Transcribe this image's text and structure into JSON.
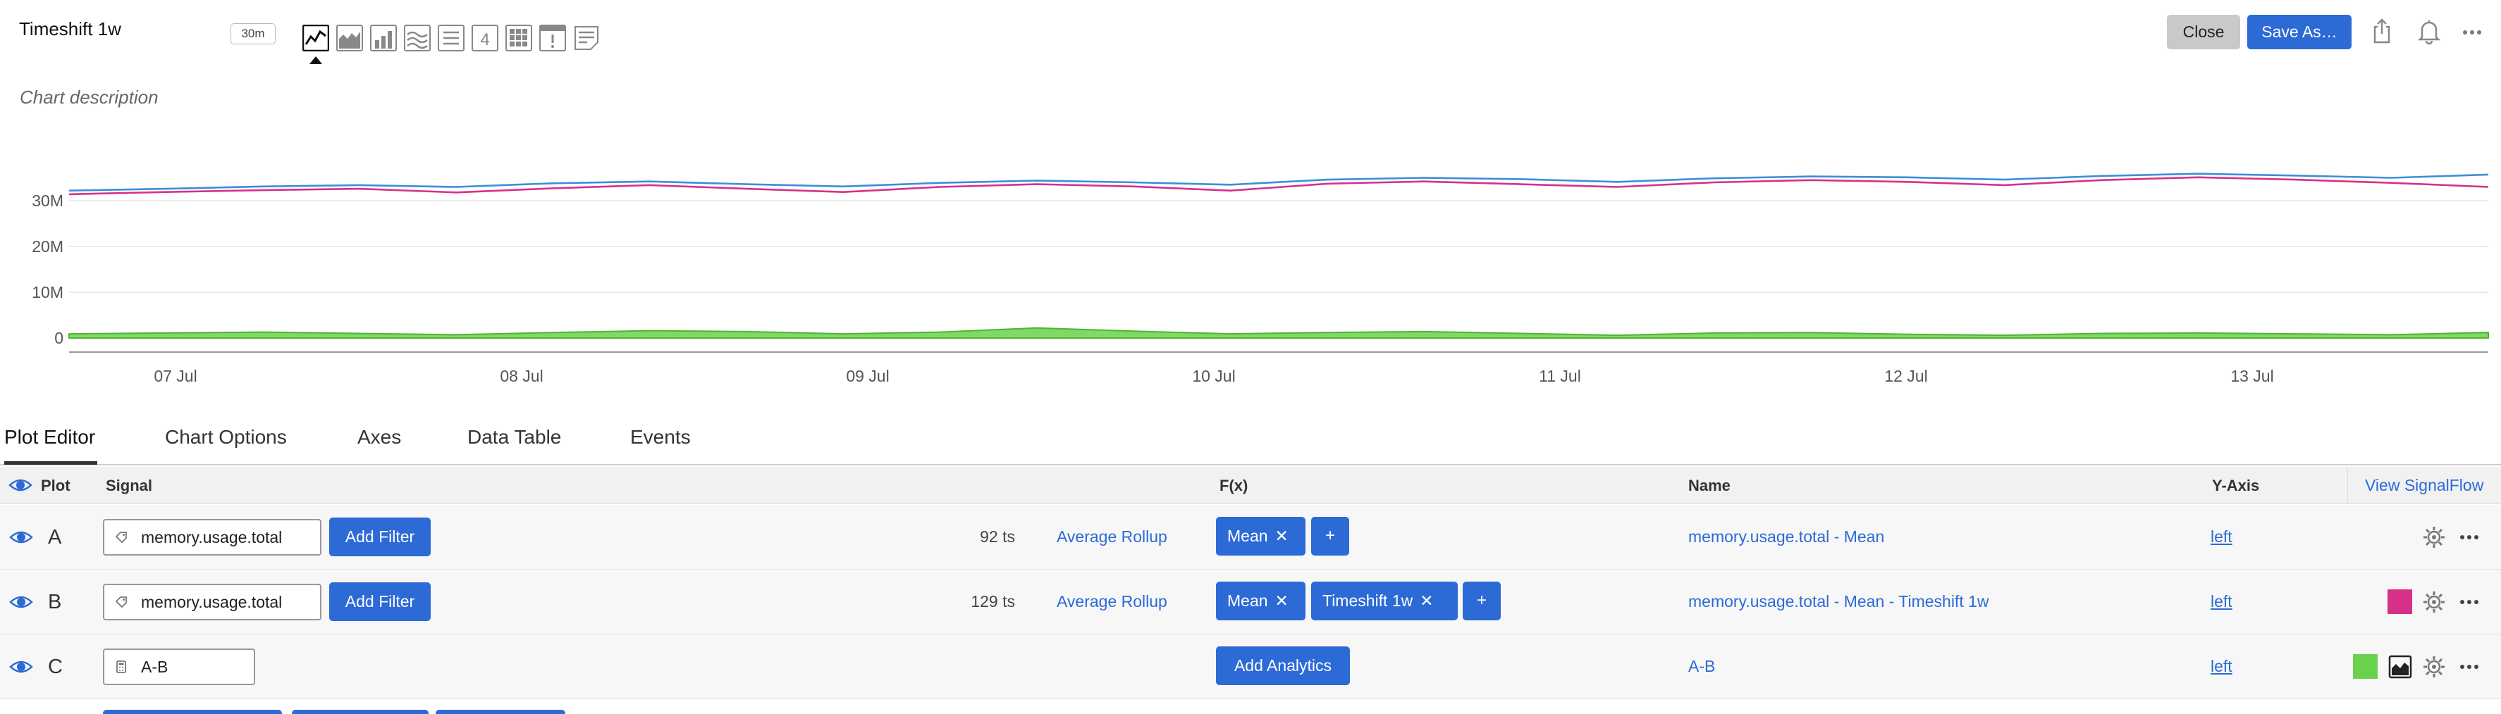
{
  "header": {
    "title": "Timeshift 1w",
    "resolution": "30m",
    "description_placeholder": "Chart description",
    "close_label": "Close",
    "save_as_label": "Save As…",
    "viz_types": [
      "line-chart-icon",
      "area-chart-icon",
      "column-chart-icon",
      "histogram-icon",
      "list-icon",
      "single-value-icon",
      "heatmap-icon",
      "event-feed-icon",
      "text-note-icon"
    ],
    "active_viz": "line-chart-icon"
  },
  "chart_data": {
    "type": "line",
    "x_labels": [
      "07 Jul",
      "08 Jul",
      "09 Jul",
      "10 Jul",
      "11 Jul",
      "12 Jul",
      "13 Jul"
    ],
    "y_ticks": [
      "0",
      "10M",
      "20M",
      "30M"
    ],
    "ylim": [
      0,
      40000000
    ],
    "grid": true,
    "series": [
      {
        "color": "#3b8fd9",
        "values": [
          32.2,
          32.6,
          33.1,
          33.4,
          33.0,
          33.8,
          34.2,
          33.6,
          33.1,
          33.9,
          34.4,
          34.0,
          33.5,
          34.6,
          35.0,
          34.7,
          34.1,
          34.9,
          35.3,
          35.1,
          34.6,
          35.4,
          35.9,
          35.5,
          35.0,
          35.7
        ]
      },
      {
        "color": "#d6318a",
        "values": [
          31.4,
          31.9,
          32.3,
          32.6,
          31.8,
          32.7,
          33.4,
          32.6,
          31.9,
          33.0,
          33.6,
          33.1,
          32.2,
          33.7,
          34.2,
          33.6,
          33.0,
          34.0,
          34.5,
          34.1,
          33.4,
          34.5,
          35.1,
          34.6,
          33.9,
          33.0
        ]
      },
      {
        "color": "#6ad14c",
        "values": [
          0.9,
          1.1,
          1.3,
          1.0,
          0.7,
          1.2,
          1.6,
          1.4,
          0.9,
          1.3,
          2.2,
          1.5,
          0.9,
          1.2,
          1.4,
          1.0,
          0.6,
          1.1,
          1.2,
          0.8,
          0.6,
          1.0,
          1.1,
          0.9,
          0.7,
          1.2
        ]
      }
    ]
  },
  "tabs": [
    "Plot Editor",
    "Chart Options",
    "Axes",
    "Data Table",
    "Events"
  ],
  "table": {
    "headers": {
      "plot": "Plot",
      "signal": "Signal",
      "fx": "F(x)",
      "name": "Name",
      "yaxis": "Y-Axis"
    },
    "view_signalflow": "View SignalFlow",
    "rows": [
      {
        "letter": "A",
        "signal": "memory.usage.total",
        "add_filter": "Add Filter",
        "ts_count": "92 ts",
        "rollup": "Average Rollup",
        "functions": [
          "Mean"
        ],
        "plus": "+",
        "name": "memory.usage.total - Mean",
        "yaxis": "left"
      },
      {
        "letter": "B",
        "signal": "memory.usage.total",
        "add_filter": "Add Filter",
        "ts_count": "129 ts",
        "rollup": "Average Rollup",
        "functions": [
          "Mean",
          "Timeshift 1w"
        ],
        "plus": "+",
        "name": "memory.usage.total - Mean - Timeshift 1w",
        "yaxis": "left",
        "color": "#d6318a"
      },
      {
        "letter": "C",
        "signal": "A-B",
        "add_analytics": "Add Analytics",
        "name": "A-B",
        "yaxis": "left",
        "color": "#6ad14c"
      }
    ]
  },
  "icons": {
    "share": "share-icon",
    "alert": "bell-icon",
    "more": "more-icon",
    "visibility": "eye-icon",
    "settings": "gear-icon",
    "tag": "tag-icon",
    "formula": "calculator-icon",
    "area-toggle": "area-chart-icon"
  }
}
